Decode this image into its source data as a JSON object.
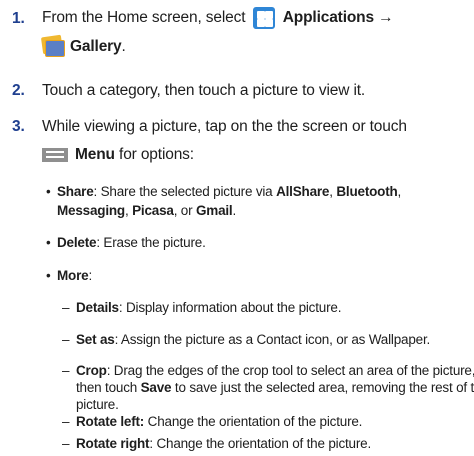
{
  "steps": [
    {
      "number": "1.",
      "text_a": "From the Home screen, select",
      "label_a": "Applications →",
      "label_b": "Gallery",
      "text_b": "."
    },
    {
      "number": "2.",
      "text": "Touch a category, then touch a picture to view it."
    },
    {
      "number": "3.",
      "text": "While viewing a picture, tap on the the screen or touch",
      "menu_label": "Menu",
      "text_after": "for options:",
      "options": {
        "share": {
          "label": "Share",
          "text_a": ": Share the selected picture via",
          "b1": "AllShare",
          "sep1": ",",
          "b2": "Bluetooth",
          "sep2": ",",
          "b3": "Messaging",
          "sep3": ",",
          "b4": "Picasa",
          "sep4": ", or",
          "b5": "Gmail",
          "end": "."
        },
        "delete": {
          "label": "Delete",
          "text": ": Erase the picture."
        },
        "more": {
          "label": "More",
          "text": ":",
          "items": [
            {
              "label": "Details",
              "text": ": Display information about the picture."
            },
            {
              "label": "Set as",
              "text": ": Assign the picture as a Contact icon, or as Wallpaper."
            },
            {
              "label": "Crop",
              "text_a": ": Drag the edges of the crop tool to select an area of the picture,",
              "text_b1": "then touch",
              "text_b_bold": "Save",
              "text_b2": "to save just the selected area, removing the rest of the",
              "text_c": "picture."
            },
            {
              "label": "Rotate left:",
              "text": "Change the orientation of the picture."
            },
            {
              "label": "Rotate right",
              "text": ": Change the orientation of the picture."
            }
          ]
        }
      }
    }
  ],
  "bullet_char": "•",
  "dash_char": "–",
  "icons": [
    "applications-icon",
    "gallery-icon",
    "menu-key-icon"
  ],
  "colors": {
    "step_number": "#1f3f8f",
    "applications_icon": "#2f86d6",
    "menu_icon": "#8f8f8f"
  }
}
